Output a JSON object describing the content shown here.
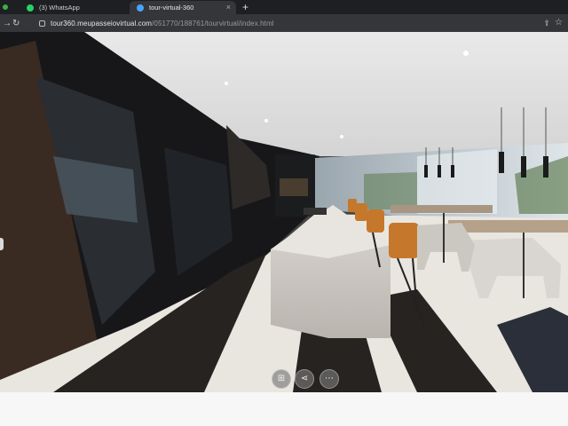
{
  "browser": {
    "tabs": [
      {
        "label": "(3) WhatsApp",
        "icon": "whatsapp-icon",
        "color": "#25d366"
      },
      {
        "label": "tour-virtual-360",
        "icon": "cloud-icon",
        "color": "#4aa3ff"
      }
    ],
    "new_tab_label": "+",
    "address": {
      "domain": "tour360.meupasseiovirtual.com",
      "path": "/051770/188761/tourvirtual/index.html"
    }
  },
  "viewer": {
    "controls": [
      {
        "name": "thumbnails-button",
        "icon": "grid-icon",
        "glyph": "⊞"
      },
      {
        "name": "share-button",
        "icon": "share-icon",
        "glyph": "⋖"
      },
      {
        "name": "more-button",
        "icon": "more-icon",
        "glyph": "⋯"
      }
    ]
  }
}
